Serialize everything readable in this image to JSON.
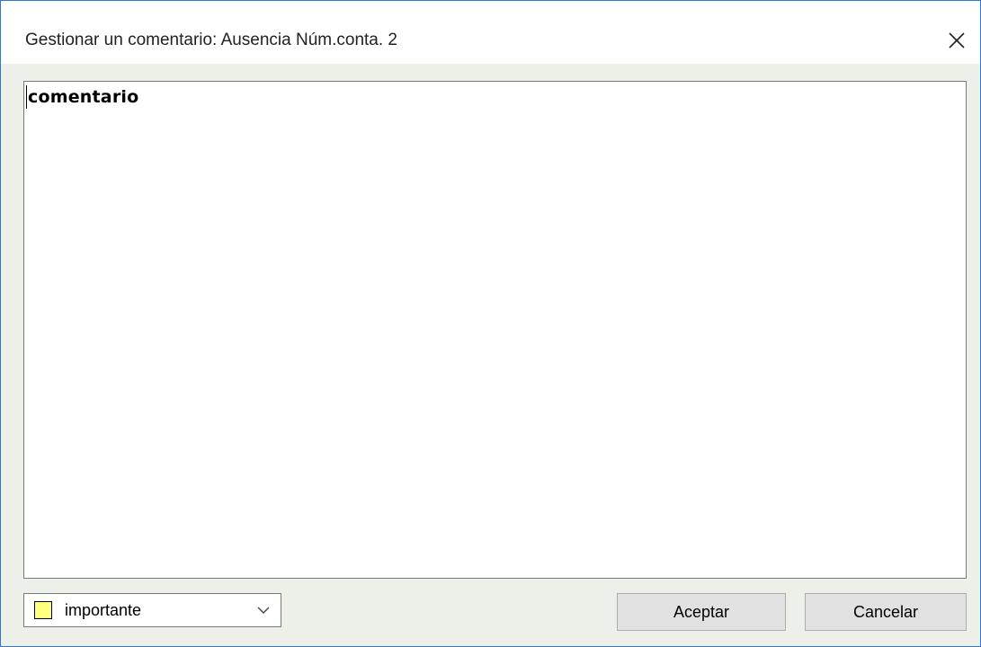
{
  "window": {
    "title": "Gestionar un comentario: Ausencia Núm.conta. 2",
    "border_color": "#2b79d6",
    "background_color": "#edf0e8"
  },
  "editor": {
    "value": "comentario"
  },
  "category": {
    "selected": "importante",
    "swatch_color": "#ffff80",
    "icon": "chevron-down-icon"
  },
  "buttons": {
    "accept_label": "Aceptar",
    "cancel_label": "Cancelar"
  },
  "icons": {
    "close": "close-icon"
  }
}
